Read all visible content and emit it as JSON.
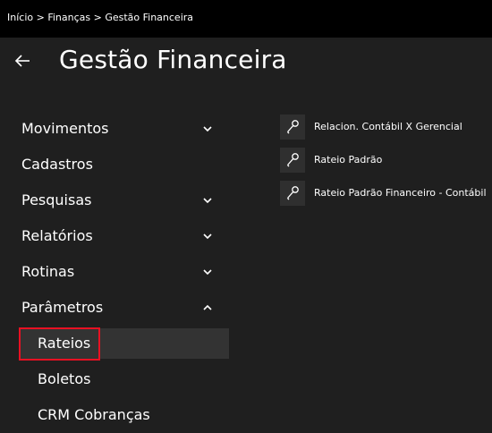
{
  "breadcrumb": "Início > Finanças > Gestão Financeira",
  "header": {
    "back_icon": "arrow-left-icon",
    "title": "Gestão Financeira"
  },
  "nav": {
    "items": [
      {
        "label": "Movimentos",
        "chevron": "chevron-down-icon"
      },
      {
        "label": "Cadastros"
      },
      {
        "label": "Pesquisas",
        "chevron": "chevron-down-icon"
      },
      {
        "label": "Relatórios",
        "chevron": "chevron-down-icon"
      },
      {
        "label": "Rotinas",
        "chevron": "chevron-down-icon"
      },
      {
        "label": "Parâmetros",
        "chevron": "chevron-up-icon"
      }
    ],
    "sub_items": [
      {
        "label": "Rateios",
        "selected": true
      },
      {
        "label": "Boletos"
      },
      {
        "label": "CRM Cobranças"
      }
    ]
  },
  "links": [
    {
      "label": "Relacion. Contábil X Gerencial",
      "icon": "wrench-icon"
    },
    {
      "label": "Rateio Padrão",
      "icon": "wrench-icon"
    },
    {
      "label": "Rateio Padrão Financeiro - Contábil",
      "icon": "wrench-icon"
    }
  ],
  "colors": {
    "background": "#1f1f1f",
    "topbar": "#000000",
    "selected_bg": "#333333",
    "highlight_border": "#e81123",
    "icon_tile": "#2f2f2f"
  }
}
